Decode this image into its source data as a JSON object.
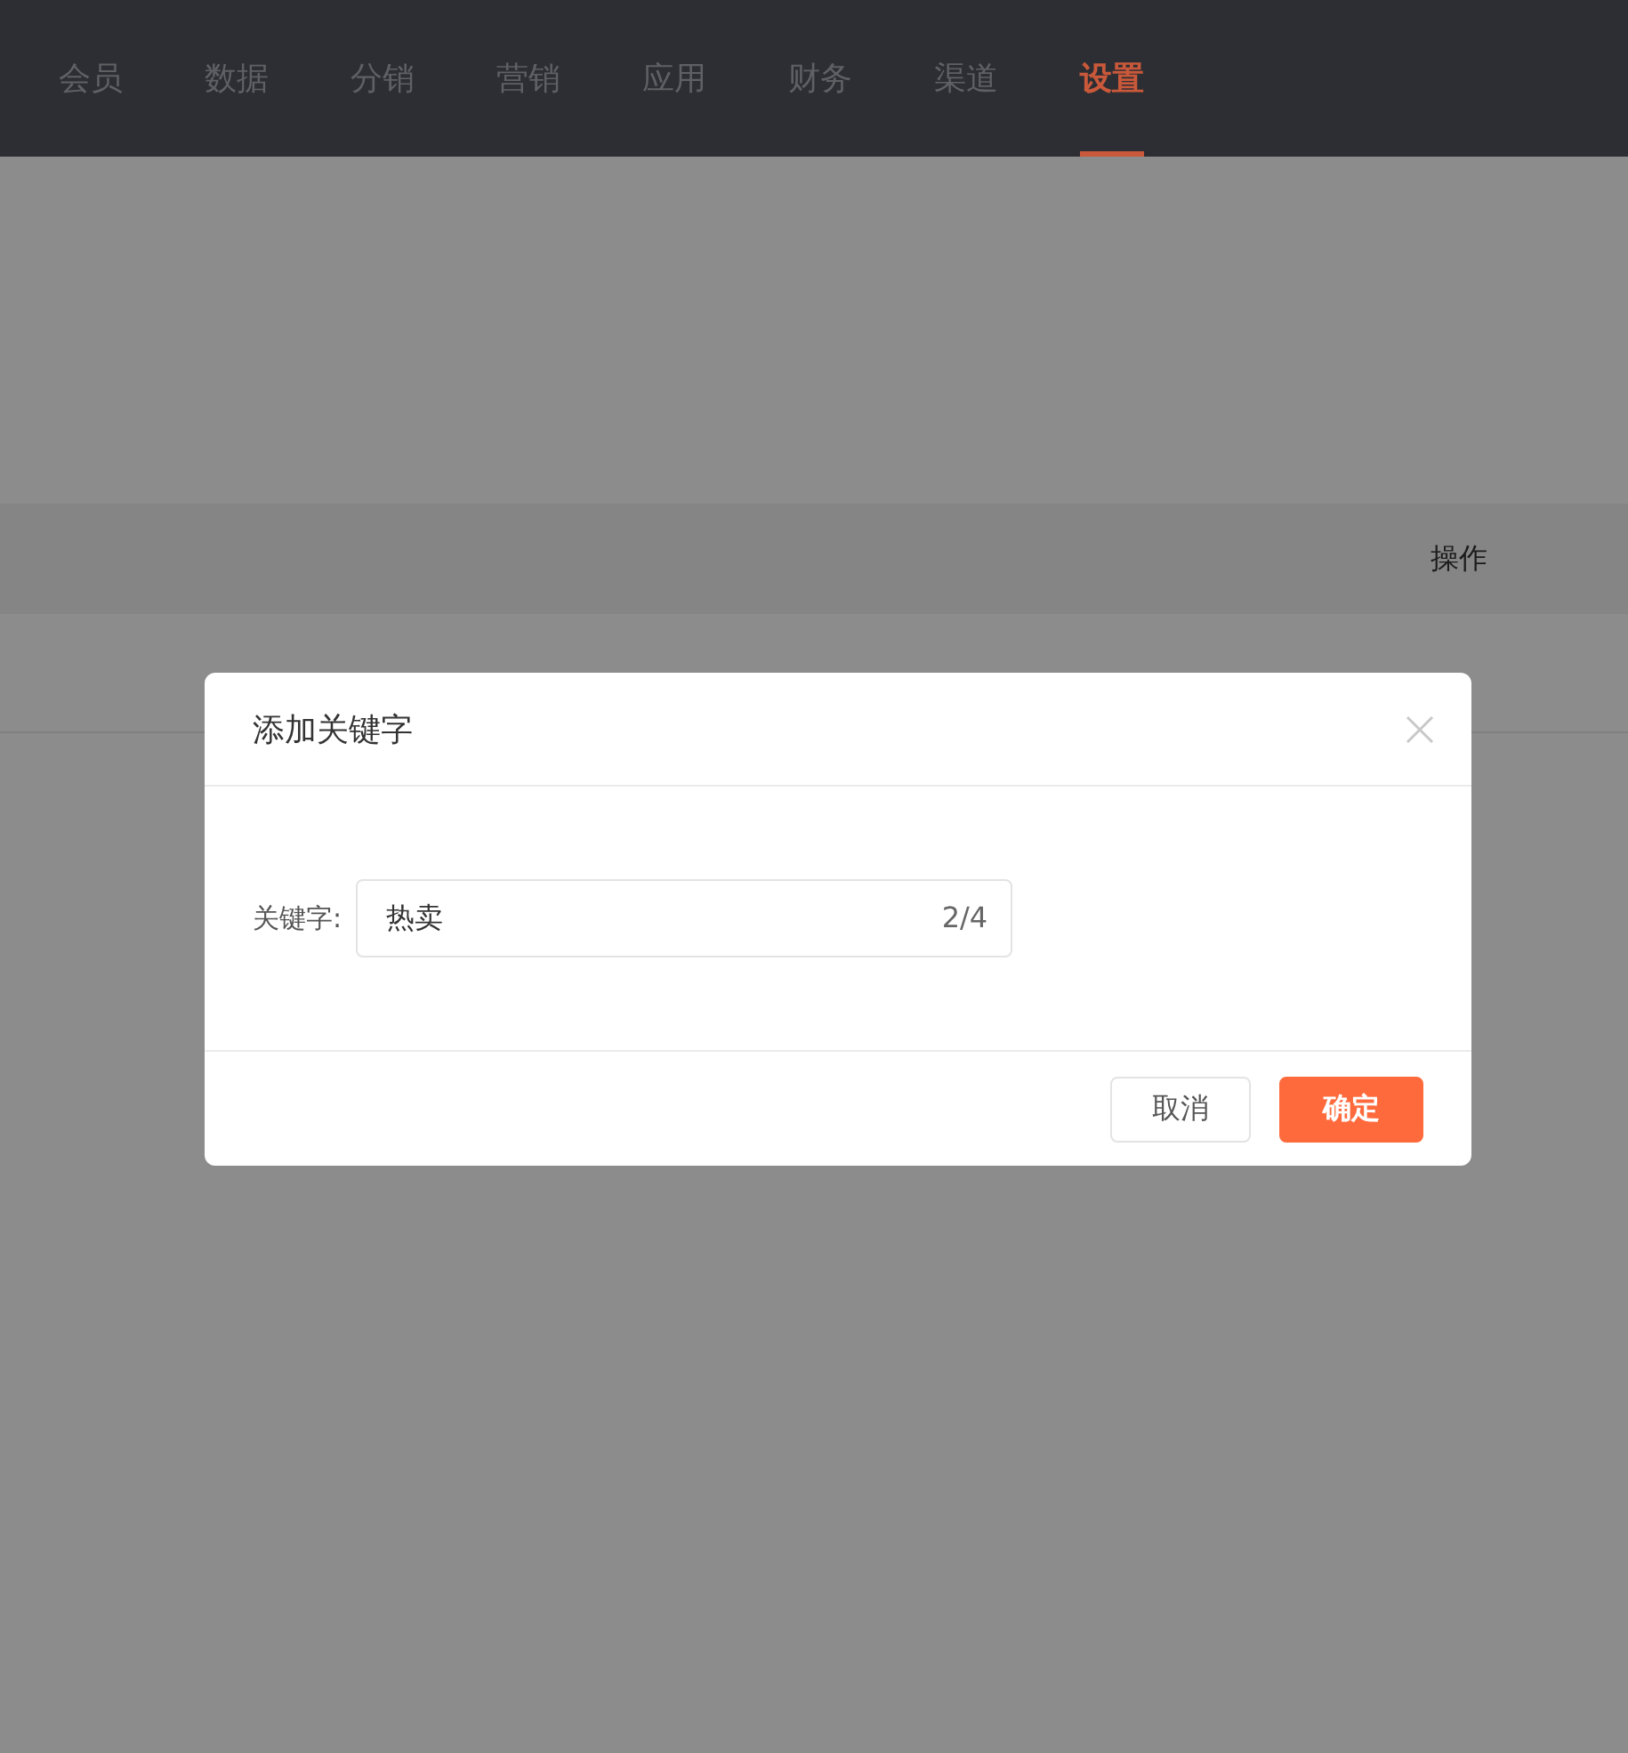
{
  "nav": {
    "items": [
      {
        "label": "会员",
        "selected": false
      },
      {
        "label": "数据",
        "selected": false
      },
      {
        "label": "分销",
        "selected": false
      },
      {
        "label": "营销",
        "selected": false
      },
      {
        "label": "应用",
        "selected": false
      },
      {
        "label": "财务",
        "selected": false
      },
      {
        "label": "渠道",
        "selected": false
      },
      {
        "label": "设置",
        "selected": true
      }
    ]
  },
  "table": {
    "columns": [
      "操作"
    ]
  },
  "dialog": {
    "title": "添加关键字",
    "field": {
      "label": "关键字:",
      "value": "热卖",
      "counter": "2/4"
    },
    "buttons": [
      {
        "label": "取消",
        "kind": "secondary"
      },
      {
        "label": "确定",
        "kind": "primary"
      }
    ]
  }
}
